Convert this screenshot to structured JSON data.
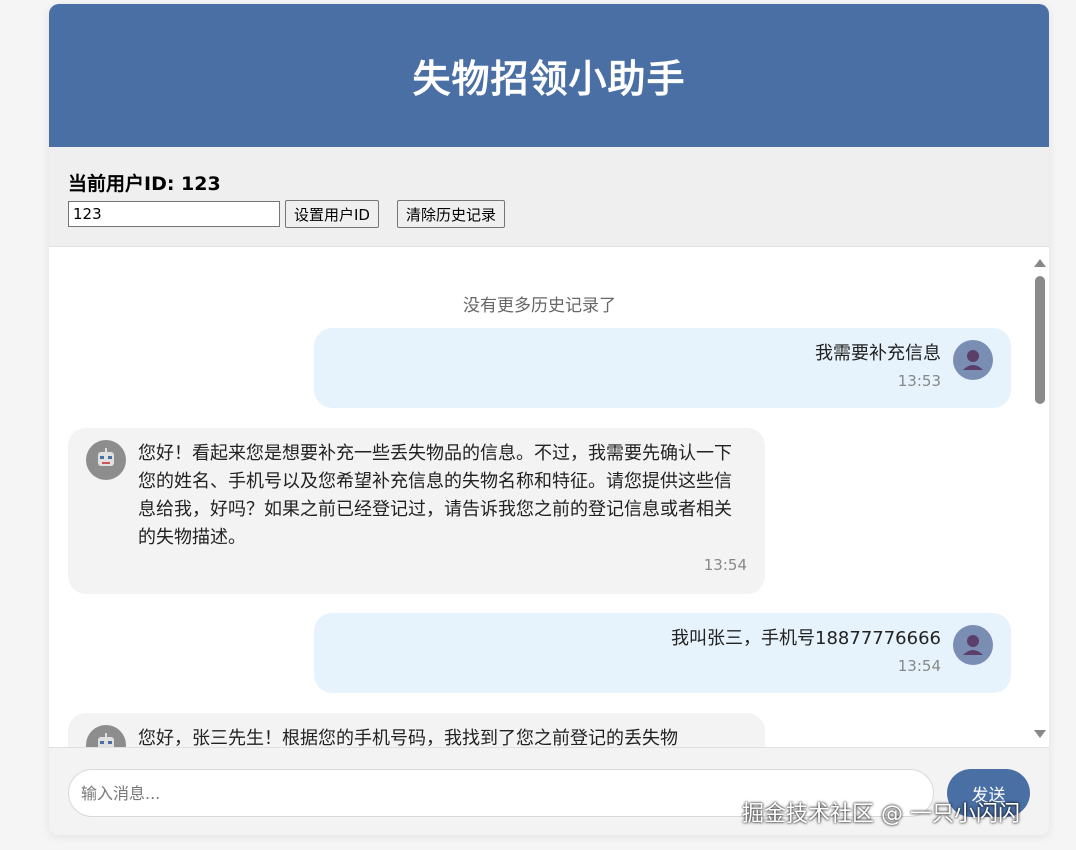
{
  "app": {
    "title": "失物招领小助手"
  },
  "user_panel": {
    "current_user_label": "当前用户ID: 123",
    "uid_value": "123",
    "set_button": "设置用户ID",
    "clear_button": "清除历史记录"
  },
  "chat": {
    "no_more_history": "没有更多历史记录了",
    "messages": [
      {
        "sender": "user",
        "text": "我需要补充信息",
        "time": "13:53"
      },
      {
        "sender": "bot",
        "text": "您好！看起来您是想要补充一些丢失物品的信息。不过，我需要先确认一下您的姓名、手机号以及您希望补充信息的失物名称和特征。请您提供这些信息给我，好吗？如果之前已经登记过，请告诉我您之前的登记信息或者相关的失物描述。",
        "time": "13:54"
      },
      {
        "sender": "user",
        "text": "我叫张三，手机号18877776666",
        "time": "13:54"
      },
      {
        "sender": "bot",
        "text": "您好，张三先生！根据您的手机号码，我找到了您之前登记的丢失物",
        "time": ""
      }
    ]
  },
  "input_bar": {
    "placeholder": "输入消息...",
    "send_button": "发送"
  },
  "watermark": "掘金技术社区 @ 一只小闪闪",
  "colors": {
    "header": "#4a6fa5",
    "user_bubble": "#e6f3fd",
    "bot_bubble": "#f3f3f3",
    "send_button": "#4a6fa5"
  },
  "icons": {
    "user_avatar": "user-avatar-icon",
    "bot_avatar": "robot-avatar-icon"
  }
}
